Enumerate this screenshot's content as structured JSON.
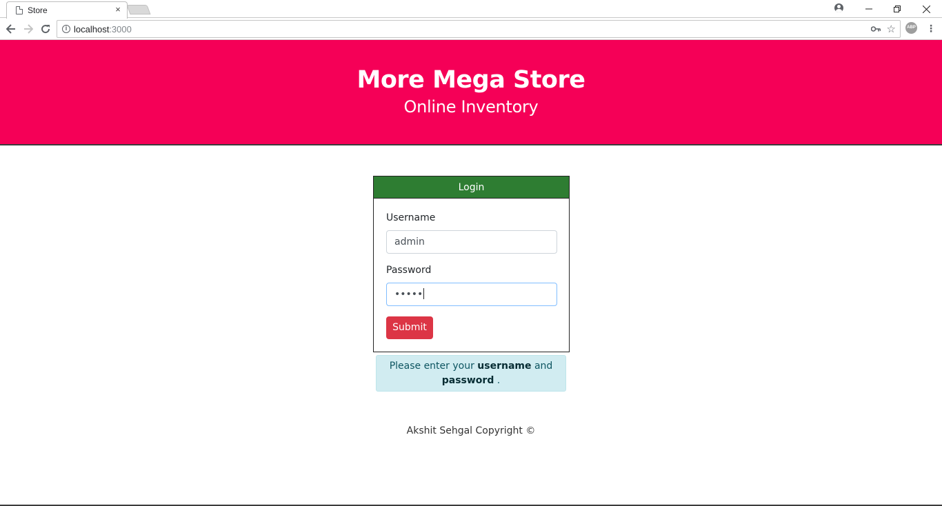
{
  "browser": {
    "tab_title": "Store",
    "tab_close": "×",
    "url_host": "localhost",
    "url_port": ":3000"
  },
  "header": {
    "title": "More Mega Store",
    "subtitle": "Online Inventory"
  },
  "login": {
    "heading": "Login",
    "username_label": "Username",
    "username_value": "admin",
    "password_label": "Password",
    "password_value": "•••••",
    "submit_label": "Submit"
  },
  "alert": {
    "prefix": "Please enter your ",
    "username_word": "username",
    "middle": " and",
    "password_word": "password",
    "suffix": " ."
  },
  "footer": {
    "text": "Akshit Sehgal Copyright ©"
  },
  "colors": {
    "header_bg": "#f50057",
    "login_header_bg": "#2e7d32",
    "submit_bg": "#dc3545",
    "alert_bg": "#d1ecf1"
  }
}
